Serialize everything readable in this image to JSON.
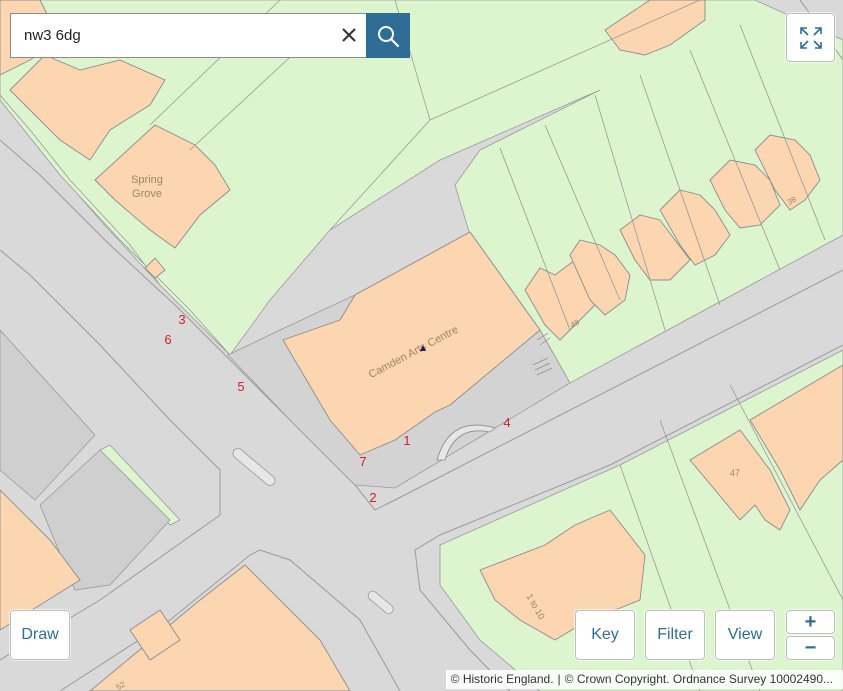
{
  "search": {
    "value": "nw3 6dg"
  },
  "controls": {
    "draw_label": "Draw",
    "key_label": "Key",
    "filter_label": "Filter",
    "view_label": "View",
    "zoom_in_label": "+",
    "zoom_out_label": "−"
  },
  "map": {
    "building_labels": {
      "spring_grove_1": "Spring",
      "spring_grove_2": "Grove",
      "camden_arts_centre": "Camden Arts Centre",
      "no_48": "48",
      "no_38": "38",
      "no_47": "47",
      "no_1_to_10": "1 to 10",
      "no_52": "52"
    },
    "site_numbers": [
      "1",
      "2",
      "3",
      "4",
      "5",
      "6",
      "7"
    ]
  },
  "attribution": {
    "historic_england": "© Historic England.",
    "crown_copyright": "© Crown Copyright. Ordnance Survey 10002490..."
  },
  "colors": {
    "road": "#d9d9d9",
    "green_space": "#dcf5cf",
    "building": "#fcd6b0",
    "outline": "#9a9a9a",
    "accent": "#2e6e96",
    "site_marker": "#d0212a"
  },
  "icons": {
    "search": "magnifier",
    "clear": "x-mark",
    "fullscreen": "expand-arrows"
  }
}
